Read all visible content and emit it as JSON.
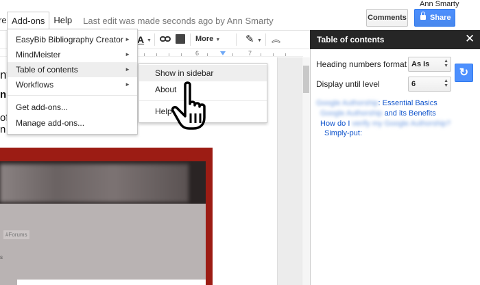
{
  "user": {
    "name": "Ann Smarty"
  },
  "menubar": {
    "cut_item": "re",
    "items": [
      "Add-ons",
      "Help"
    ],
    "last_edit": "Last edit was made seconds ago by Ann Smarty"
  },
  "header_buttons": {
    "comments": "Comments",
    "share": "Share"
  },
  "toolbar": {
    "more_label": "More",
    "font_color_glyph": "A",
    "pencil_glyph": "✎"
  },
  "ruler": {
    "labels": [
      "6",
      "7"
    ]
  },
  "addons_menu": {
    "items": [
      {
        "label": "EasyBib Bibliography Creator",
        "submenu": true
      },
      {
        "label": "MindMeister",
        "submenu": true
      },
      {
        "label": "Table of contents",
        "submenu": true
      },
      {
        "label": "Workflows",
        "submenu": true
      },
      {
        "label": "Get add-ons...",
        "submenu": false
      },
      {
        "label": "Manage add-ons...",
        "submenu": false
      }
    ]
  },
  "toc_submenu": {
    "items": [
      {
        "label": "Show in sidebar"
      },
      {
        "label": "About"
      },
      {
        "label": "Help"
      }
    ]
  },
  "sidebar": {
    "title": "Table of contents",
    "heading_format_label": "Heading numbers format",
    "heading_format_value": "As Is",
    "display_until_label": "Display until level",
    "display_until_value": "6",
    "toc_entries": [
      {
        "blurred": "Google Authorship",
        "text": ": Essential Basics"
      },
      {
        "blurred": "Google Authorship",
        "text": " and its Benefits"
      },
      {
        "text": "How do I ",
        "blurred": "verify my Google Authorship?"
      },
      {
        "text": "Simply-put:"
      }
    ]
  },
  "document": {
    "fragment_1": "nt",
    "fragment_2": "n",
    "fragment_3": "of",
    "fragment_4": "n",
    "screenshot_tag": "#Forums",
    "screenshot_letter": "s"
  },
  "colors": {
    "share_blue": "#4d90fe",
    "sidebar_header": "#262626",
    "link_blue": "#1155cc",
    "image_frame_red": "#9c1c14"
  },
  "icons": [
    "link-icon",
    "comment-icon",
    "pencil-icon",
    "collapse-icon",
    "close-icon",
    "refresh-icon",
    "hand-cursor-icon",
    "lock-icon",
    "submenu-arrow-icon"
  ]
}
